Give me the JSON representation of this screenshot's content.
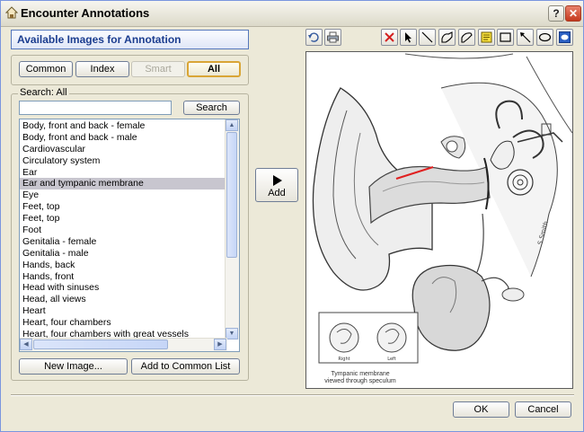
{
  "window": {
    "title": "Encounter Annotations",
    "help_label": "?",
    "close_label": "✕"
  },
  "panel": {
    "title": "Available Images for Annotation"
  },
  "tabs": [
    {
      "label": "Common",
      "state": "normal"
    },
    {
      "label": "Index",
      "state": "normal"
    },
    {
      "label": "Smart",
      "state": "disabled"
    },
    {
      "label": "All",
      "state": "active"
    }
  ],
  "search": {
    "legend": "Search: All",
    "value": "",
    "button_label": "Search"
  },
  "image_list": {
    "selected_index": 5,
    "items": [
      "Body, front and back - female",
      "Body, front and back - male",
      "Cardiovascular",
      "Circulatory system",
      "Ear",
      "Ear and tympanic membrane",
      "Eye",
      "Feet, top",
      "Feet, top",
      "Foot",
      "Genitalia - female",
      "Genitalia - male",
      "Hands, back",
      "Hands, front",
      "Head with sinuses",
      "Head, all views",
      "Heart",
      "Heart, four chambers",
      "Heart, four chambers with great vessels"
    ]
  },
  "list_buttons": {
    "new_image": "New Image...",
    "add_common": "Add to Common List"
  },
  "add_button": {
    "label": "Add"
  },
  "toolbar": {
    "left_tools": [
      "refresh-icon",
      "print-icon"
    ],
    "drawing_tools": [
      "delete-icon",
      "select-pointer-icon",
      "line-icon",
      "freehand-icon",
      "curve-icon",
      "text-note-icon",
      "rectangle-icon",
      "arrow-icon",
      "ellipse-icon",
      "fill-icon"
    ]
  },
  "canvas": {
    "image_name": "Ear and tympanic membrane",
    "inset_labels": {
      "right": "Right",
      "left": "Left"
    },
    "caption_line1": "Tympanic membrane",
    "caption_line2": "viewed through speculum",
    "annotation_color": "#e02020"
  },
  "footer": {
    "ok_label": "OK",
    "cancel_label": "Cancel"
  }
}
